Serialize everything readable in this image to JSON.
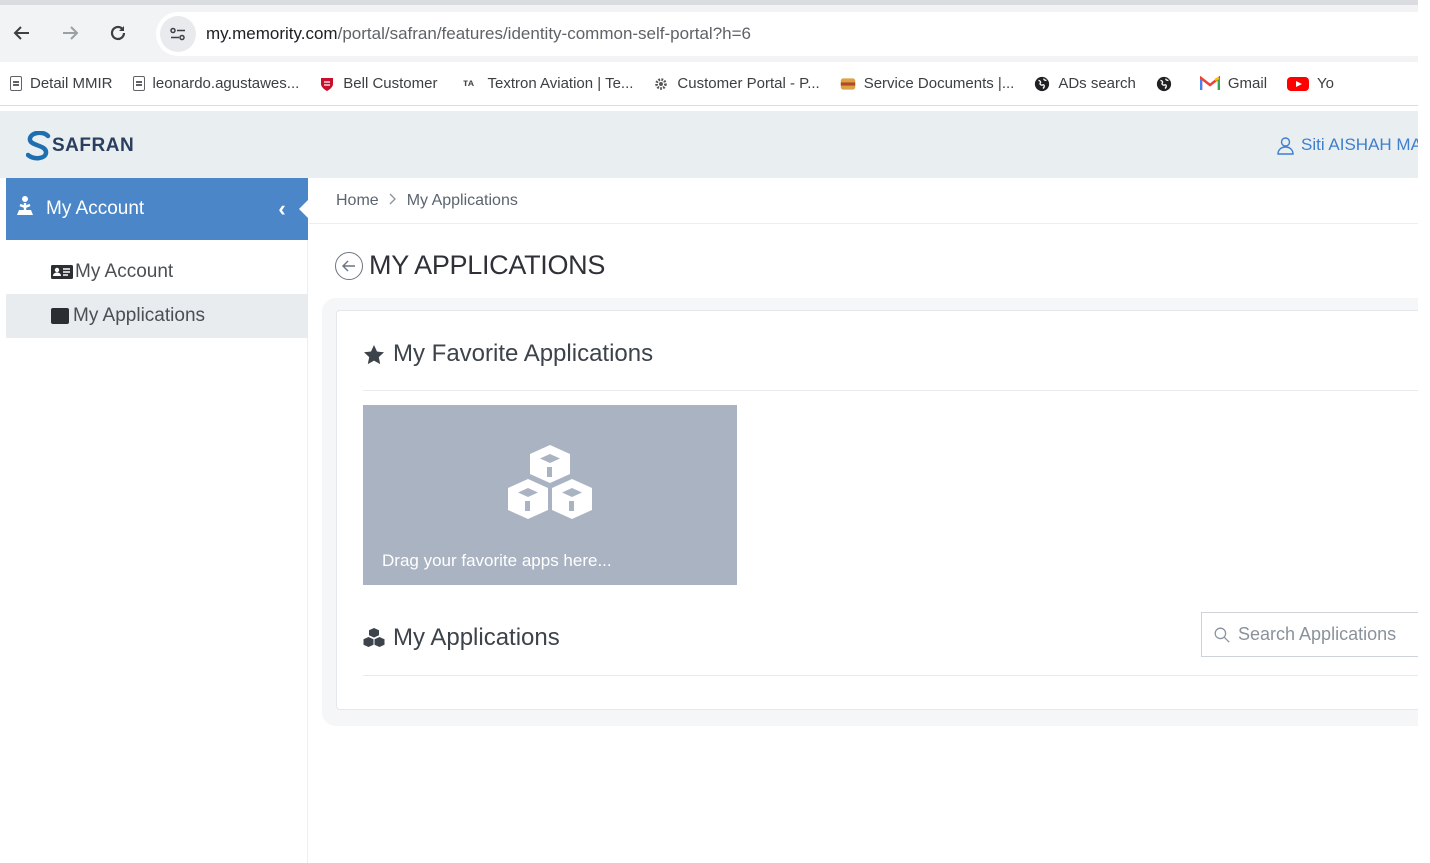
{
  "browser": {
    "url_host": "my.memority.com",
    "url_path": "/portal/safran/features/identity-common-self-portal?h=6",
    "site_info_icon": "tune-icon",
    "bookmarks": [
      {
        "label": "Detail MMIR",
        "icon": "page-icon"
      },
      {
        "label": "leonardo.agustawes...",
        "icon": "page-icon"
      },
      {
        "label": "Bell Customer",
        "icon": "bell-shield-icon"
      },
      {
        "label": "Textron Aviation | Te...",
        "icon": "textron-icon"
      },
      {
        "label": "Customer Portal - P...",
        "icon": "gear-icon"
      },
      {
        "label": "Service Documents |...",
        "icon": "service-doc-icon"
      },
      {
        "label": "ADs search",
        "icon": "globe-icon"
      },
      {
        "label": "",
        "icon": "globe-icon"
      },
      {
        "label": "Gmail",
        "icon": "gmail-icon"
      },
      {
        "label": "Yo",
        "icon": "youtube-icon"
      }
    ]
  },
  "header": {
    "logo_text": "SAFRAN",
    "user_name": "Siti AISHAH MA"
  },
  "sidebar": {
    "section_label": "My Account",
    "collapse_glyph": "‹",
    "items": [
      {
        "label": "My Account",
        "icon": "id-card-icon",
        "active": false
      },
      {
        "label": "My Applications",
        "icon": "window-icon",
        "active": true
      }
    ]
  },
  "breadcrumb": {
    "home": "Home",
    "separator": ">",
    "current": "My Applications"
  },
  "main": {
    "page_title": "MY APPLICATIONS",
    "favorites_title": "My Favorite Applications",
    "favorites_hint": "Drag your favorite apps here...",
    "applications_title": "My Applications",
    "search_placeholder": "Search Applications"
  },
  "colors": {
    "accent_blue": "#4a86c8",
    "link_blue": "#3f7fce",
    "dropzone_gray": "#a9b3c2",
    "header_bg": "#e9eef1"
  }
}
